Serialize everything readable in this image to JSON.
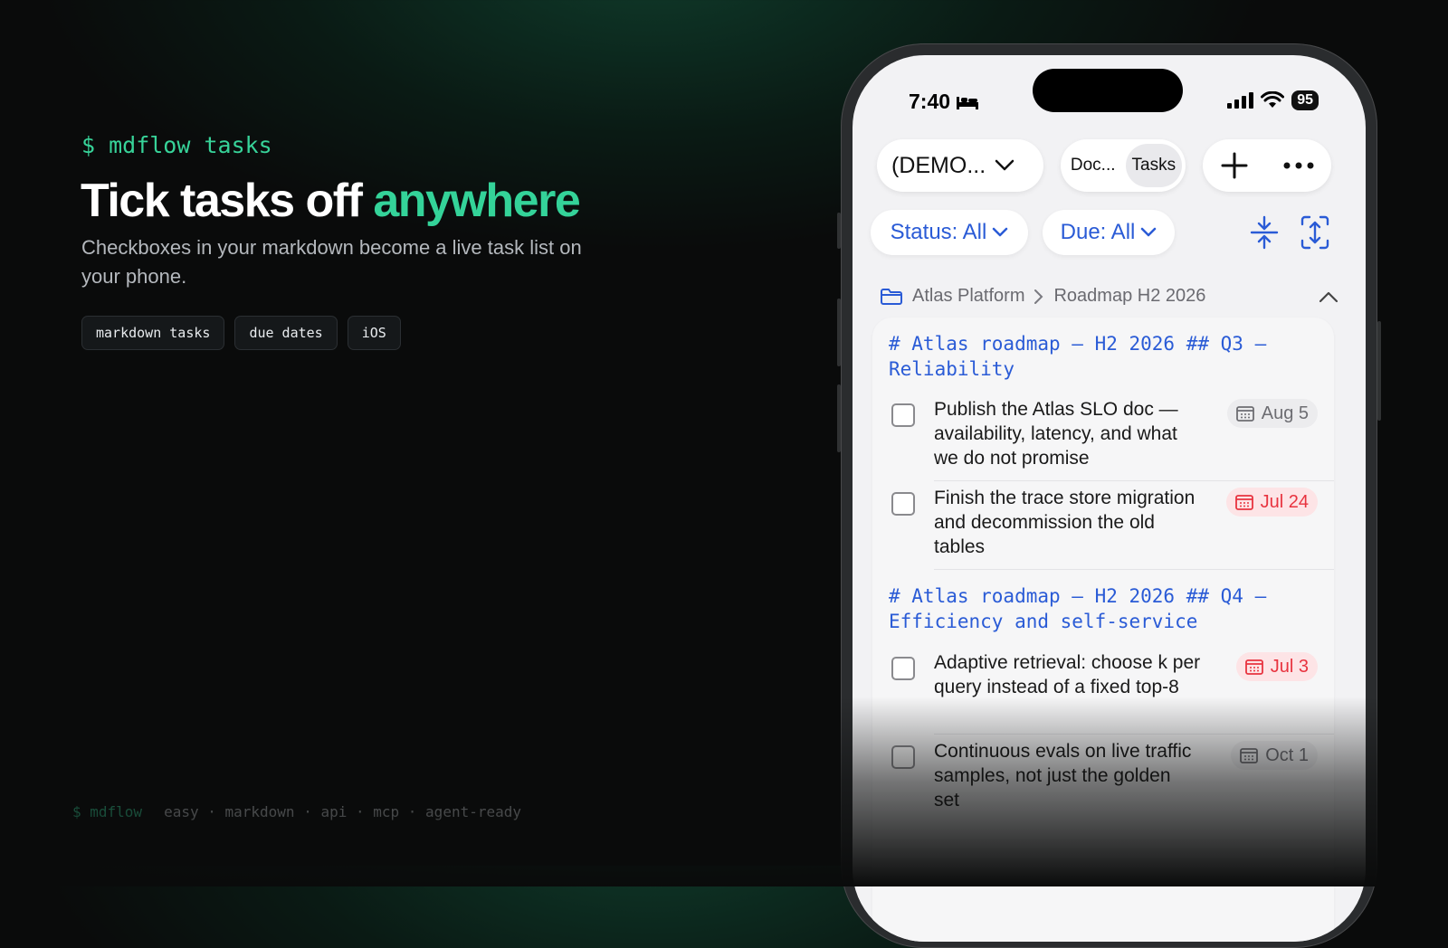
{
  "hero": {
    "prompt": "$ mdflow tasks",
    "headline_main": "Tick tasks off ",
    "headline_accent": "anywhere",
    "subtitle": "Checkboxes in your markdown become a live task list on your phone.",
    "tags": [
      "markdown tasks",
      "due dates",
      "iOS"
    ]
  },
  "footer": {
    "brand": "$ mdflow",
    "tagline": "easy · markdown · api · mcp · agent-ready"
  },
  "phone": {
    "status": {
      "time": "7:40",
      "battery": "95"
    },
    "toolbar": {
      "project": "(DEMO...",
      "segments": [
        "Doc...",
        "Tasks"
      ],
      "active_segment": "Tasks"
    },
    "filters": {
      "status": "Status: All",
      "due": "Due: All"
    },
    "breadcrumb": {
      "workspace": "Atlas Platform",
      "document": "Roadmap H2 2026"
    },
    "sections": [
      {
        "heading": "# Atlas roadmap — H2 2026  ## Q3 — Reliability",
        "tasks": [
          {
            "text": "Publish the Atlas SLO doc — availability, latency, and what we do not promise",
            "due": "Aug 5",
            "overdue": false
          },
          {
            "text": "Finish the trace store migration and decommission the old tables",
            "due": "Jul 24",
            "overdue": true
          }
        ]
      },
      {
        "heading": "# Atlas roadmap — H2 2026  ## Q4 — Efficiency and self-service",
        "tasks": [
          {
            "text": "Adaptive retrieval: choose k per query instead of a fixed top-8",
            "due": "Jul 3",
            "overdue": true
          },
          {
            "text": "Continuous evals on live traffic samples, not just the golden set",
            "due": "Oct 1",
            "overdue": false
          }
        ]
      }
    ]
  },
  "colors": {
    "accent_green": "#34d399",
    "link_blue": "#2a5bd6",
    "overdue_red": "#e8333f"
  }
}
